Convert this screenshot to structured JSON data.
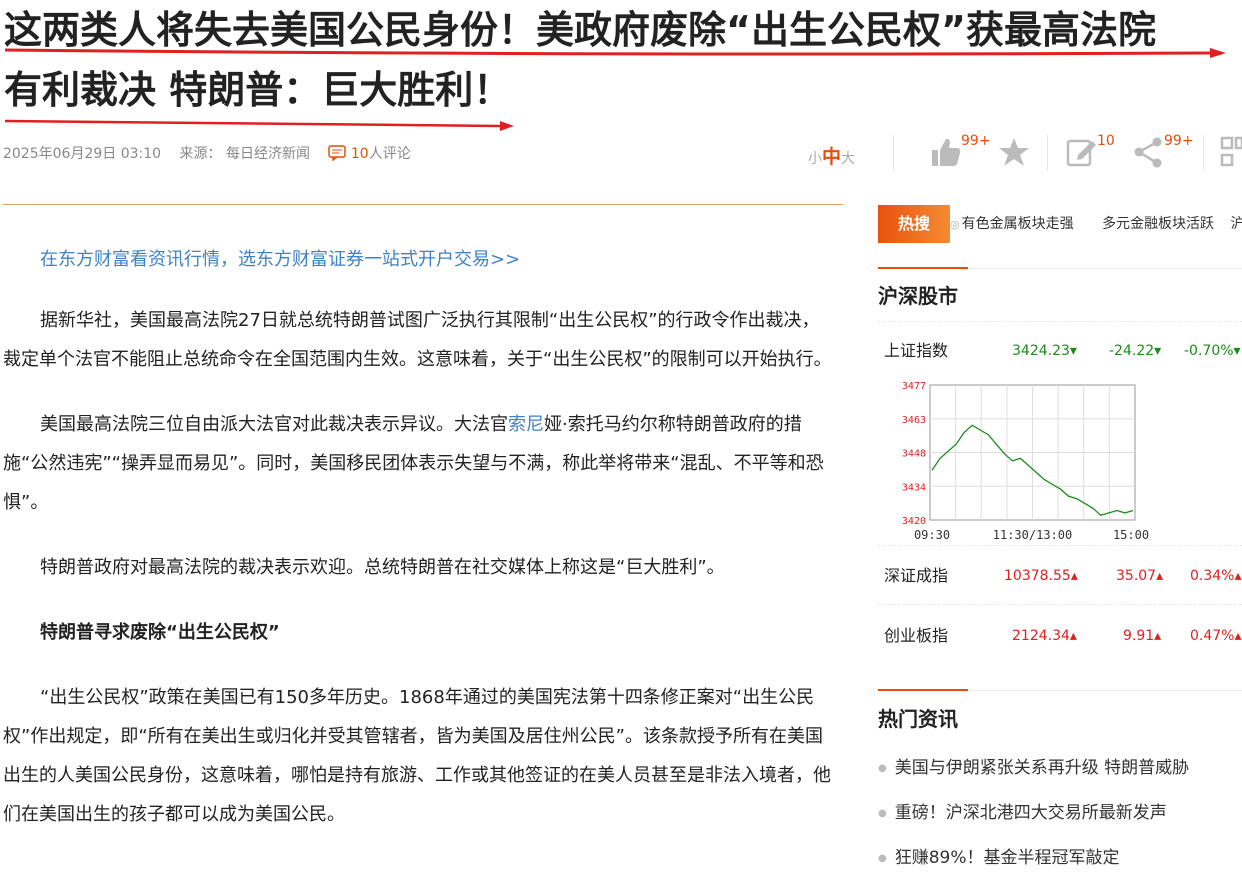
{
  "article": {
    "title_line1": "这两类人将失去美国公民身份！美政府废除“出生公民权”获最高法院",
    "title_line2": "有利裁决 特朗普：巨大胜利！",
    "datetime": "2025年06月29日 03:10",
    "source_label": "来源：",
    "source": "每日经济新闻",
    "comment_count": "10",
    "comment_suffix": "人评论",
    "font_small": "小",
    "font_mid": "中",
    "font_large": "大",
    "like_count": "99+",
    "edit_count": "10",
    "share_count": "99+",
    "promo": "在东方财富看资讯行情，选东方财富证券一站式开户交易>>",
    "p1": "据新华社，美国最高法院27日就总统特朗普试图广泛执行其限制“出生公民权”的行政令作出裁决，裁定单个法官不能阻止总统命令在全国范围内生效。这意味着，关于“出生公民权”的限制可以开始执行。",
    "p2_a": "美国最高法院三位自由派大法官对此裁决表示异议。大法官",
    "p2_link": "索尼",
    "p2_b": "娅·索托马约尔称特朗普政府的措施“公然违宪”“操弄显而易见”。同时，美国移民团体表示失望与不满，称此举将带来“混乱、不平等和恐惧”。",
    "p3": "特朗普政府对最高法院的裁决表示欢迎。总统特朗普在社交媒体上称这是“巨大胜利”。",
    "subheading": "特朗普寻求废除“出生公民权”",
    "p4": "“出生公民权”政策在美国已有150多年历史。1868年通过的美国宪法第十四条修正案对“出生公民权”作出规定，即“所有在美出生或归化并受其管辖者，皆为美国及居住州公民”。该条款授予所有在美国出生的人美国公民身份，这意味着，哪怕是持有旅游、工作或其他签证的在美人员甚至是非法入境者，他们在美国出生的孩子都可以成为美国公民。"
  },
  "sidebar": {
    "hot_label": "热搜",
    "hot_items": [
      "有色金属板块走强",
      "多元金融板块活跃",
      "沪深"
    ],
    "market_title": "沪深股市",
    "indices": [
      {
        "name": "上证指数",
        "price": "3424.23",
        "change": "-24.22",
        "pct": "-0.70%",
        "dir": "down"
      },
      {
        "name": "深证成指",
        "price": "10378.55",
        "change": "35.07",
        "pct": "0.34%",
        "dir": "up"
      },
      {
        "name": "创业板指",
        "price": "2124.34",
        "change": "9.91",
        "pct": "0.47%",
        "dir": "up"
      }
    ],
    "news_title": "热门资讯",
    "news": [
      "美国与伊朗紧张关系再升级 特朗普威胁",
      "重磅！沪深北港四大交易所最新发声",
      "狂赚89%！基金半程冠军敲定"
    ]
  },
  "colors": {
    "accent": "#e84c0b",
    "link": "#3f82c5",
    "down": "#1a8c1a",
    "up": "#e02020"
  },
  "chart_data": {
    "type": "line",
    "series": [
      {
        "values": [
          3441,
          3446,
          3449,
          3452,
          3457,
          3460,
          3458,
          3456,
          3452,
          3448,
          3445,
          3446,
          3443,
          3440,
          3437,
          3435,
          3433,
          3430,
          3429,
          3427,
          3425,
          3422,
          3423,
          3424,
          3423,
          3424
        ]
      }
    ],
    "y_ticks": [
      "3477",
      "3463",
      "3448",
      "3434",
      "3420"
    ],
    "x_ticks": [
      "09:30",
      "11:30/13:00",
      "15:00"
    ],
    "ylim": [
      3420,
      3477
    ],
    "grid": true
  }
}
